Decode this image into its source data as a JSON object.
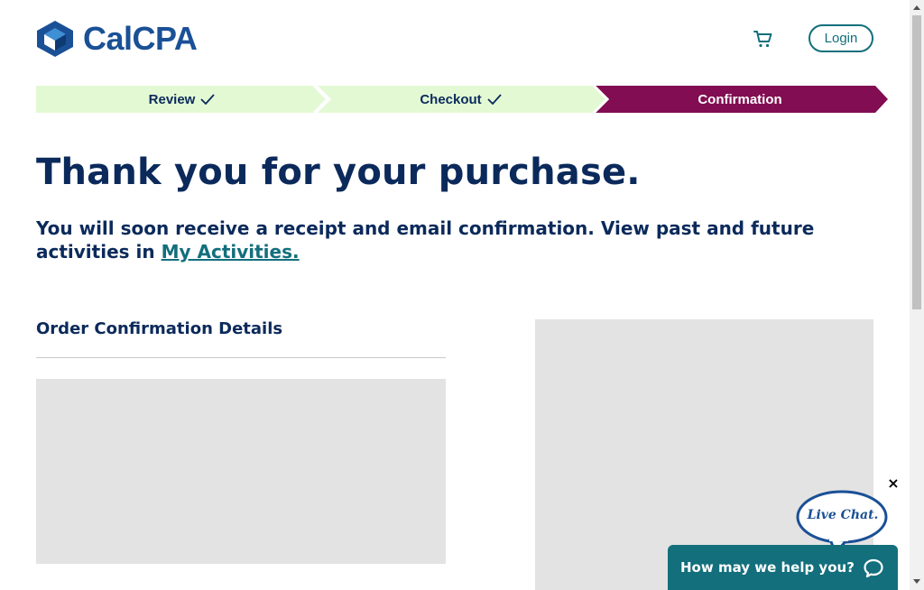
{
  "header": {
    "logo_text": "CalCPA",
    "login_label": "Login"
  },
  "stepper": {
    "steps": [
      {
        "label": "Review",
        "state": "complete"
      },
      {
        "label": "Checkout",
        "state": "complete"
      },
      {
        "label": "Confirmation",
        "state": "active"
      }
    ]
  },
  "main": {
    "title": "Thank you for your purchase.",
    "subtitle_text": "You will soon receive a receipt and email confirmation. View past and future activities in ",
    "subtitle_link": "My Activities.",
    "order_heading": "Order Confirmation Details"
  },
  "chat": {
    "bubble_label": "Live Chat.",
    "bar_text": "How may we help you?",
    "close_label": "×"
  },
  "colors": {
    "navy": "#0b2a5b",
    "teal": "#136f7c",
    "step_complete_bg": "#e3f9d4",
    "step_active_bg": "#820d52",
    "brand_blue": "#1a5096",
    "placeholder_gray": "#e3e3e3"
  },
  "icons": [
    "logo-icon",
    "cart-icon",
    "checkmark-icon",
    "chat-icon",
    "close-icon"
  ]
}
